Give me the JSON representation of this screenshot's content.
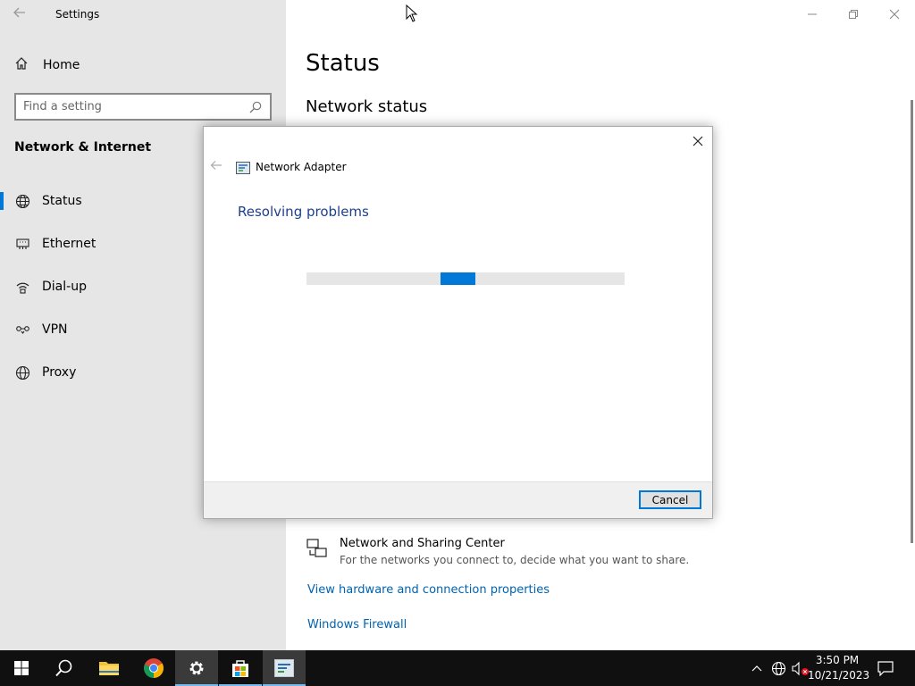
{
  "app": {
    "title": "Settings"
  },
  "sidebar": {
    "home_label": "Home",
    "search_placeholder": "Find a setting",
    "section_title": "Network & Internet",
    "items": [
      {
        "label": "Status",
        "icon": "globe-icon",
        "selected": true
      },
      {
        "label": "Ethernet",
        "icon": "ethernet-icon",
        "selected": false
      },
      {
        "label": "Dial-up",
        "icon": "dialup-icon",
        "selected": false
      },
      {
        "label": "VPN",
        "icon": "vpn-icon",
        "selected": false
      },
      {
        "label": "Proxy",
        "icon": "globe-icon",
        "selected": false
      }
    ]
  },
  "main": {
    "page_title": "Status",
    "subhead": "Network status",
    "sharing_title": "Network and Sharing Center",
    "sharing_desc": "For the networks you connect to, decide what you want to share.",
    "link_hardware": "View hardware and connection properties",
    "link_firewall": "Windows Firewall"
  },
  "dialog": {
    "header_label": "Network Adapter",
    "heading": "Resolving problems",
    "cancel_label": "Cancel",
    "accent": "#0078d7"
  },
  "taskbar": {
    "time": "3:50 PM",
    "date": "10/21/2023"
  }
}
